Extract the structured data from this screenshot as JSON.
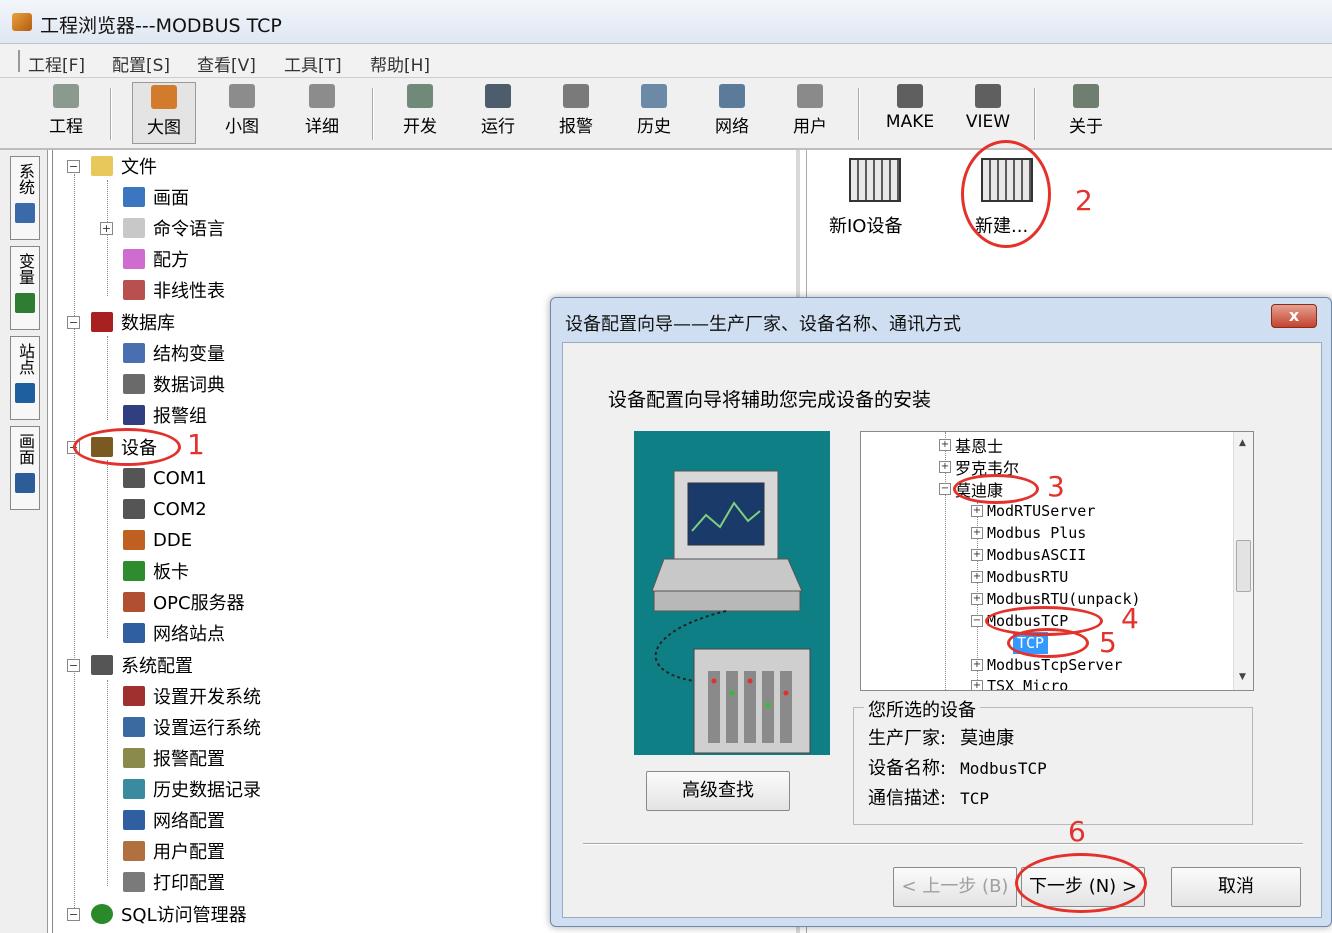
{
  "window": {
    "title": "工程浏览器---MODBUS TCP"
  },
  "menu": [
    "工程[F]",
    "配置[S]",
    "查看[V]",
    "工具[T]",
    "帮助[H]"
  ],
  "toolbar": [
    {
      "label": "工程",
      "icon": "project-icon",
      "color": "#8b9a8e"
    },
    {
      "label": "大图",
      "icon": "large-icons-icon",
      "color": "#d27b2c"
    },
    {
      "label": "小图",
      "icon": "small-icons-icon",
      "color": "#8c8c8c"
    },
    {
      "label": "详细",
      "icon": "details-icon",
      "color": "#8c8c8c"
    },
    {
      "label": "开发",
      "icon": "develop-icon",
      "color": "#6f8a79"
    },
    {
      "label": "运行",
      "icon": "run-icon",
      "color": "#4d5d6c"
    },
    {
      "label": "报警",
      "icon": "alarm-icon",
      "color": "#7a7a7a"
    },
    {
      "label": "历史",
      "icon": "history-icon",
      "color": "#6c8aa6"
    },
    {
      "label": "网络",
      "icon": "network-icon",
      "color": "#5c7b9b"
    },
    {
      "label": "用户",
      "icon": "user-key-icon",
      "color": "#8a8a8a"
    },
    {
      "label": "MAKE",
      "icon": "make-icon",
      "color": "#5f5f5f"
    },
    {
      "label": "VIEW",
      "icon": "view-icon",
      "color": "#5f5f5f"
    },
    {
      "label": "关于",
      "icon": "about-icon",
      "color": "#6f7f6f"
    }
  ],
  "sidetabs": [
    {
      "label": "系统",
      "color": "#3a6aa8"
    },
    {
      "label": "变量",
      "color": "#2e7d32"
    },
    {
      "label": "站点",
      "color": "#1e5fa0"
    },
    {
      "label": "画面",
      "color": "#2c5d99"
    }
  ],
  "tree": [
    {
      "label": "文件",
      "level": 0,
      "expand": "−",
      "color": "#e8c85a"
    },
    {
      "label": "画面",
      "level": 1,
      "color": "#3c76c0"
    },
    {
      "label": "命令语言",
      "level": 1,
      "expand": "+",
      "color": "#c8c8c8"
    },
    {
      "label": "配方",
      "level": 1,
      "color": "#d06bd0"
    },
    {
      "label": "非线性表",
      "level": 1,
      "color": "#b85050"
    },
    {
      "label": "数据库",
      "level": 0,
      "expand": "−",
      "color": "#a82020"
    },
    {
      "label": "结构变量",
      "level": 1,
      "color": "#4a6fb0"
    },
    {
      "label": "数据词典",
      "level": 1,
      "color": "#6a6a6a"
    },
    {
      "label": "报警组",
      "level": 1,
      "color": "#2f3f7f"
    },
    {
      "label": "设备",
      "level": 0,
      "expand": "−",
      "color": "#7a5a20"
    },
    {
      "label": "COM1",
      "level": 1,
      "color": "#555555"
    },
    {
      "label": "COM2",
      "level": 1,
      "color": "#555555"
    },
    {
      "label": "DDE",
      "level": 1,
      "color": "#c06020"
    },
    {
      "label": "板卡",
      "level": 1,
      "color": "#2e8b2e"
    },
    {
      "label": "OPC服务器",
      "level": 1,
      "color": "#b05030"
    },
    {
      "label": "网络站点",
      "level": 1,
      "color": "#2f5fa0"
    },
    {
      "label": "系统配置",
      "level": 0,
      "expand": "−",
      "color": "#555555"
    },
    {
      "label": "设置开发系统",
      "level": 1,
      "color": "#a03030"
    },
    {
      "label": "设置运行系统",
      "level": 1,
      "color": "#3a6aa0"
    },
    {
      "label": "报警配置",
      "level": 1,
      "color": "#8a8a4a"
    },
    {
      "label": "历史数据记录",
      "level": 1,
      "color": "#3a8aa0"
    },
    {
      "label": "网络配置",
      "level": 1,
      "color": "#2f5fa0"
    },
    {
      "label": "用户配置",
      "level": 1,
      "color": "#b07040"
    },
    {
      "label": "打印配置",
      "level": 1,
      "color": "#7a7a7a"
    },
    {
      "label": "SQL访问管理器",
      "level": 0,
      "expand": "−",
      "color": "#2a8a2a"
    }
  ],
  "rightpane": [
    {
      "label": "新IO设备"
    },
    {
      "label": "新建..."
    }
  ],
  "annotations": [
    "1",
    "2",
    "3",
    "4",
    "5",
    "6"
  ],
  "dialog": {
    "title": "设备配置向导——生产厂家、设备名称、通讯方式",
    "close": "x",
    "intro": "设备配置向导将辅助您完成设备的安装",
    "advanced_search": "高级查找",
    "devtree": [
      {
        "label": "基恩士",
        "level": 0,
        "expand": "+",
        "mono": false
      },
      {
        "label": "罗克韦尔",
        "level": 0,
        "expand": "+",
        "mono": false
      },
      {
        "label": "莫迪康",
        "level": 0,
        "expand": "−",
        "mono": false
      },
      {
        "label": "ModRTUServer",
        "level": 1,
        "expand": "+",
        "mono": true
      },
      {
        "label": "Modbus Plus",
        "level": 1,
        "expand": "+",
        "mono": true
      },
      {
        "label": "ModbusASCII",
        "level": 1,
        "expand": "+",
        "mono": true
      },
      {
        "label": "ModbusRTU",
        "level": 1,
        "expand": "+",
        "mono": true
      },
      {
        "label": "ModbusRTU(unpack)",
        "level": 1,
        "expand": "+",
        "mono": true
      },
      {
        "label": "ModbusTCP",
        "level": 1,
        "expand": "−",
        "mono": true
      },
      {
        "label": "TCP",
        "level": 2,
        "mono": true,
        "selected": true
      },
      {
        "label": "ModbusTcpServer",
        "level": 1,
        "expand": "+",
        "mono": true
      },
      {
        "label": "TSX Micro",
        "level": 1,
        "expand": "+",
        "mono": true
      }
    ],
    "selected_device": {
      "legend": "您所选的设备",
      "vendor_label": "生产厂家:",
      "vendor": "莫迪康",
      "name_label": "设备名称:",
      "name": "ModbusTCP",
      "comm_label": "通信描述:",
      "comm": "TCP"
    },
    "prev": "< 上一步 (B)",
    "next": "下一步 (N) >",
    "cancel": "取消"
  }
}
